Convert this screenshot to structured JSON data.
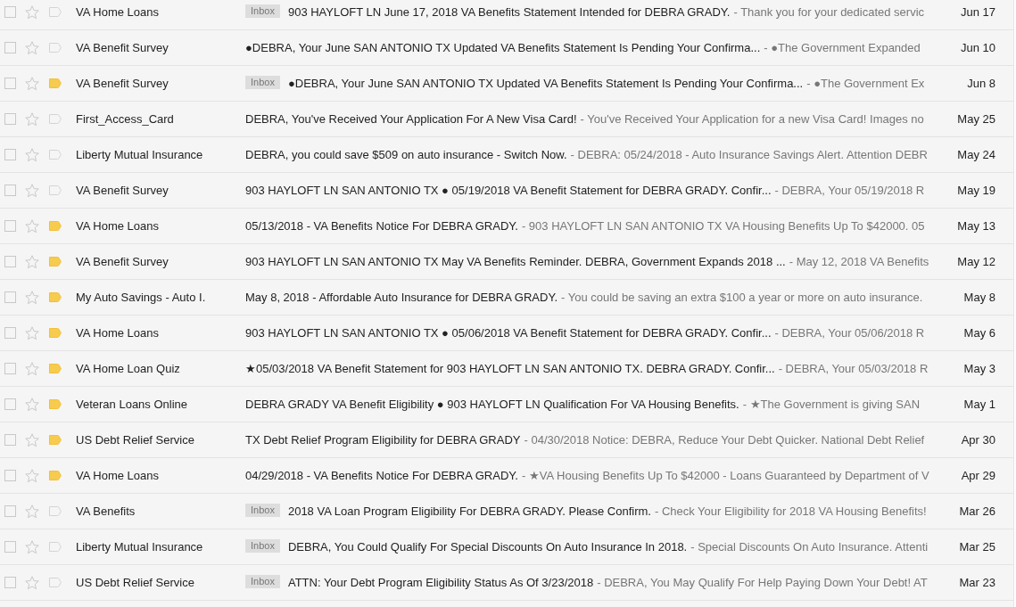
{
  "rows": [
    {
      "checked": false,
      "starred": false,
      "important": false,
      "sender": "VA Home Loans",
      "label": "Inbox",
      "subject": "903 HAYLOFT LN June 17, 2018 VA Benefits Statement Intended for DEBRA GRADY.",
      "snippet": "- Thank you for your dedicated servic",
      "date": "Jun 17"
    },
    {
      "checked": false,
      "starred": false,
      "important": false,
      "sender": "VA Benefit Survey",
      "subject": "●DEBRA, Your June SAN ANTONIO TX Updated VA Benefits Statement Is Pending Your Confirma...",
      "snippet": "- ●The Government Expanded",
      "date": "Jun 10"
    },
    {
      "checked": false,
      "starred": false,
      "important": true,
      "sender": "VA Benefit Survey",
      "label": "Inbox",
      "subject": "●DEBRA, Your June SAN ANTONIO TX Updated VA Benefits Statement Is Pending Your Confirma...",
      "snippet": "- ●The Government Ex",
      "date": "Jun 8"
    },
    {
      "checked": false,
      "starred": false,
      "important": false,
      "sender": "First_Access_Card",
      "subject": "DEBRA, You've Received Your Application For A New Visa Card!",
      "snippet": "- You've Received Your Application for a new Visa Card! Images no",
      "date": "May 25"
    },
    {
      "checked": false,
      "starred": false,
      "important": false,
      "sender": "Liberty Mutual Insurance",
      "subject": "DEBRA, you could save $509 on auto insurance - Switch Now.",
      "snippet": "- DEBRA: 05/24/2018 - Auto Insurance Savings Alert. Attention DEBR",
      "date": "May 24"
    },
    {
      "checked": false,
      "starred": false,
      "important": false,
      "sender": "VA Benefit Survey",
      "subject": "903 HAYLOFT LN SAN ANTONIO TX ● 05/19/2018 VA Benefit Statement for DEBRA GRADY. Confir...",
      "snippet": "- DEBRA, Your 05/19/2018 R",
      "date": "May 19"
    },
    {
      "checked": false,
      "starred": false,
      "important": true,
      "sender": "VA Home Loans",
      "subject": "05/13/2018 - VA Benefits Notice For DEBRA GRADY.",
      "snippet": "- 903 HAYLOFT LN SAN ANTONIO TX VA Housing Benefits Up To $42000. 05",
      "date": "May 13"
    },
    {
      "checked": false,
      "starred": false,
      "important": true,
      "sender": "VA Benefit Survey",
      "subject": "903 HAYLOFT LN SAN ANTONIO TX May VA Benefits Reminder. DEBRA, Government Expands 2018 ...",
      "snippet": "- May 12, 2018 VA Benefits",
      "date": "May 12"
    },
    {
      "checked": false,
      "starred": false,
      "important": true,
      "sender": "My Auto Savings - Auto I.",
      "subject": "May 8, 2018 - Affordable Auto Insurance for DEBRA GRADY.",
      "snippet": "- You could be saving an extra $100 a year or more on auto insurance.",
      "date": "May 8"
    },
    {
      "checked": false,
      "starred": false,
      "important": true,
      "sender": "VA Home Loans",
      "subject": "903 HAYLOFT LN SAN ANTONIO TX ● 05/06/2018 VA Benefit Statement for DEBRA GRADY. Confir...",
      "snippet": "- DEBRA, Your 05/06/2018 R",
      "date": "May 6"
    },
    {
      "checked": false,
      "starred": false,
      "important": true,
      "sender": "VA Home Loan Quiz",
      "subject": "★05/03/2018 VA Benefit Statement for 903 HAYLOFT LN SAN ANTONIO TX. DEBRA GRADY. Confir...",
      "snippet": "- DEBRA, Your 05/03/2018 R",
      "date": "May 3"
    },
    {
      "checked": false,
      "starred": false,
      "important": true,
      "sender": "Veteran Loans Online",
      "subject": "DEBRA GRADY VA Benefit Eligibility ● 903 HAYLOFT LN Qualification For VA Housing Benefits.",
      "snippet": "- ★The Government is giving SAN",
      "date": "May 1"
    },
    {
      "checked": false,
      "starred": false,
      "important": true,
      "sender": "US Debt Relief Service",
      "subject": "TX Debt Relief Program Eligibility for DEBRA GRADY",
      "snippet": "- 04/30/2018 Notice: DEBRA, Reduce Your Debt Quicker. National Debt Relief",
      "date": "Apr 30"
    },
    {
      "checked": false,
      "starred": false,
      "important": true,
      "sender": "VA Home Loans",
      "subject": "04/29/2018 - VA Benefits Notice For DEBRA GRADY.",
      "snippet": "- ★VA Housing Benefits Up To $42000 - Loans Guaranteed by Department of V",
      "date": "Apr 29"
    },
    {
      "checked": false,
      "starred": false,
      "important": false,
      "sender": "VA Benefits",
      "label": "Inbox",
      "subject": "2018 VA Loan Program Eligibility For DEBRA GRADY. Please Confirm.",
      "snippet": "- Check Your Eligibility for 2018 VA Housing Benefits!",
      "date": "Mar 26"
    },
    {
      "checked": false,
      "starred": false,
      "important": false,
      "sender": "Liberty Mutual Insurance",
      "label": "Inbox",
      "subject": "DEBRA, You Could Qualify For Special Discounts On Auto Insurance In 2018.",
      "snippet": "- Special Discounts On Auto Insurance. Attenti",
      "date": "Mar 25"
    },
    {
      "checked": false,
      "starred": false,
      "important": false,
      "sender": "US Debt Relief Service",
      "label": "Inbox",
      "subject": "ATTN: Your Debt Program Eligibility Status As Of 3/23/2018",
      "snippet": "- DEBRA, You May Qualify For Help Paying Down Your Debt! AT",
      "date": "Mar 23"
    }
  ]
}
